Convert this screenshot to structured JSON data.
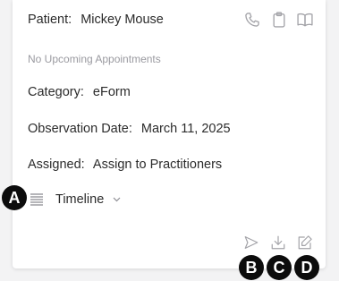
{
  "patient": {
    "label": "Patient:",
    "name": "Mickey Mouse"
  },
  "appointments": {
    "status": "No Upcoming Appointments"
  },
  "category": {
    "label": "Category:",
    "value": "eForm"
  },
  "observation_date": {
    "label": "Observation Date:",
    "value": "March 11, 2025"
  },
  "assigned": {
    "label": "Assigned:",
    "value": "Assign to Practitioners"
  },
  "view_selector": {
    "label": "Timeline",
    "icon": "list-icon"
  },
  "header_icons": [
    "phone-icon",
    "clipboard-icon",
    "book-icon"
  ],
  "action_icons": [
    "send-icon",
    "download-icon",
    "edit-icon"
  ],
  "callouts": {
    "a": "A",
    "b": "B",
    "c": "C",
    "d": "D"
  },
  "colors": {
    "icon": "#a3a3a8",
    "text": "#2b2b2b",
    "muted": "#9a9aa0",
    "callout": "#0c0c0c"
  }
}
